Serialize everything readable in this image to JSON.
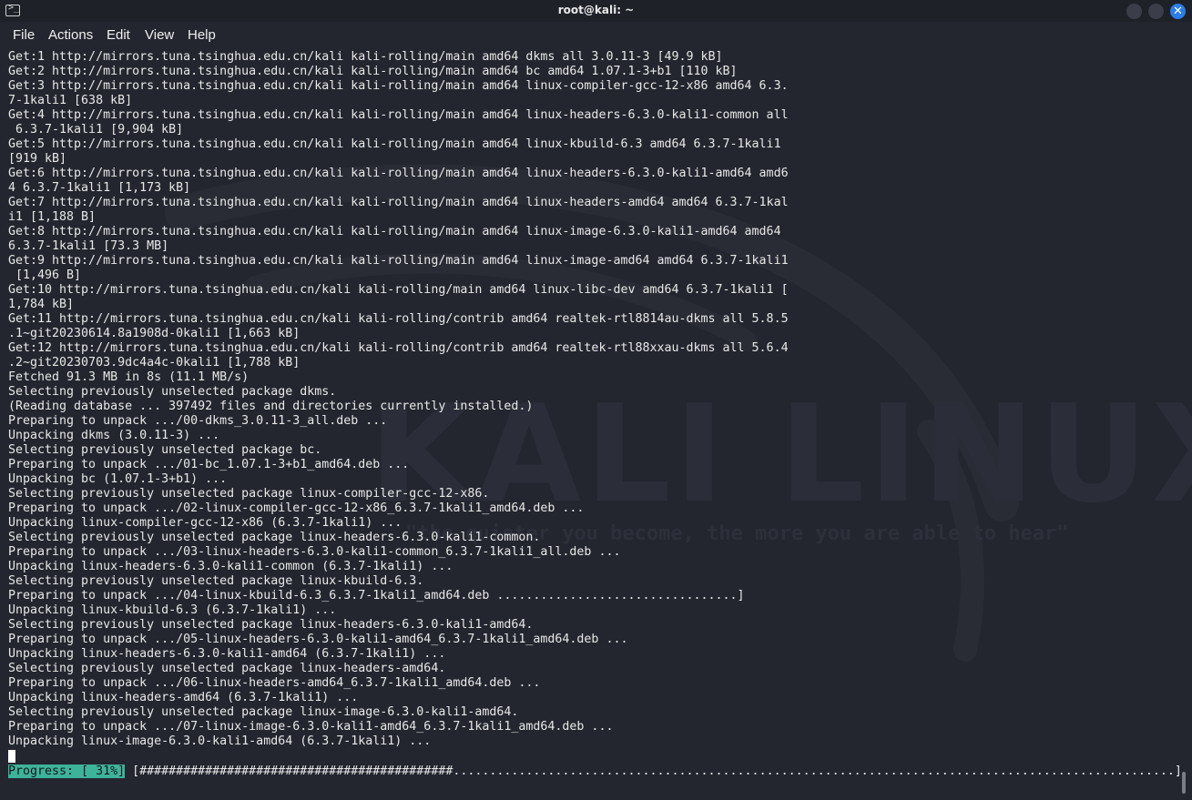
{
  "window": {
    "title": "root@kali: ~",
    "close_glyph": "✕"
  },
  "menu": {
    "items": [
      "File",
      "Actions",
      "Edit",
      "View",
      "Help"
    ]
  },
  "watermark": {
    "logo_text": "KALI LINUX",
    "tagline": "\"the quieter you become, the more you are able to hear\""
  },
  "terminal": {
    "lines": [
      "Get:1 http://mirrors.tuna.tsinghua.edu.cn/kali kali-rolling/main amd64 dkms all 3.0.11-3 [49.9 kB]",
      "Get:2 http://mirrors.tuna.tsinghua.edu.cn/kali kali-rolling/main amd64 bc amd64 1.07.1-3+b1 [110 kB]",
      "Get:3 http://mirrors.tuna.tsinghua.edu.cn/kali kali-rolling/main amd64 linux-compiler-gcc-12-x86 amd64 6.3.",
      "7-1kali1 [638 kB]",
      "Get:4 http://mirrors.tuna.tsinghua.edu.cn/kali kali-rolling/main amd64 linux-headers-6.3.0-kali1-common all",
      " 6.3.7-1kali1 [9,904 kB]",
      "Get:5 http://mirrors.tuna.tsinghua.edu.cn/kali kali-rolling/main amd64 linux-kbuild-6.3 amd64 6.3.7-1kali1",
      "[919 kB]",
      "Get:6 http://mirrors.tuna.tsinghua.edu.cn/kali kali-rolling/main amd64 linux-headers-6.3.0-kali1-amd64 amd6",
      "4 6.3.7-1kali1 [1,173 kB]",
      "Get:7 http://mirrors.tuna.tsinghua.edu.cn/kali kali-rolling/main amd64 linux-headers-amd64 amd64 6.3.7-1kal",
      "i1 [1,188 B]",
      "Get:8 http://mirrors.tuna.tsinghua.edu.cn/kali kali-rolling/main amd64 linux-image-6.3.0-kali1-amd64 amd64",
      "6.3.7-1kali1 [73.3 MB]",
      "Get:9 http://mirrors.tuna.tsinghua.edu.cn/kali kali-rolling/main amd64 linux-image-amd64 amd64 6.3.7-1kali1",
      " [1,496 B]",
      "Get:10 http://mirrors.tuna.tsinghua.edu.cn/kali kali-rolling/main amd64 linux-libc-dev amd64 6.3.7-1kali1 [",
      "1,784 kB]",
      "Get:11 http://mirrors.tuna.tsinghua.edu.cn/kali kali-rolling/contrib amd64 realtek-rtl8814au-dkms all 5.8.5",
      ".1~git20230614.8a1908d-0kali1 [1,663 kB]",
      "Get:12 http://mirrors.tuna.tsinghua.edu.cn/kali kali-rolling/contrib amd64 realtek-rtl88xxau-dkms all 5.6.4",
      ".2~git20230703.9dc4a4c-0kali1 [1,788 kB]",
      "Fetched 91.3 MB in 8s (11.1 MB/s)",
      "Selecting previously unselected package dkms.",
      "(Reading database ... 397492 files and directories currently installed.)",
      "Preparing to unpack .../00-dkms_3.0.11-3_all.deb ...",
      "Unpacking dkms (3.0.11-3) ...",
      "Selecting previously unselected package bc.",
      "Preparing to unpack .../01-bc_1.07.1-3+b1_amd64.deb ...",
      "Unpacking bc (1.07.1-3+b1) ...",
      "Selecting previously unselected package linux-compiler-gcc-12-x86.",
      "Preparing to unpack .../02-linux-compiler-gcc-12-x86_6.3.7-1kali1_amd64.deb ...",
      "Unpacking linux-compiler-gcc-12-x86 (6.3.7-1kali1) ...",
      "Selecting previously unselected package linux-headers-6.3.0-kali1-common.",
      "Preparing to unpack .../03-linux-headers-6.3.0-kali1-common_6.3.7-1kali1_all.deb ...",
      "Unpacking linux-headers-6.3.0-kali1-common (6.3.7-1kali1) ...",
      "Selecting previously unselected package linux-kbuild-6.3.",
      "Preparing to unpack .../04-linux-kbuild-6.3_6.3.7-1kali1_amd64.deb .................................]",
      "Unpacking linux-kbuild-6.3 (6.3.7-1kali1) ...",
      "Selecting previously unselected package linux-headers-6.3.0-kali1-amd64.",
      "Preparing to unpack .../05-linux-headers-6.3.0-kali1-amd64_6.3.7-1kali1_amd64.deb ...",
      "Unpacking linux-headers-6.3.0-kali1-amd64 (6.3.7-1kali1) ...",
      "Selecting previously unselected package linux-headers-amd64.",
      "Preparing to unpack .../06-linux-headers-amd64_6.3.7-1kali1_amd64.deb ...",
      "Unpacking linux-headers-amd64 (6.3.7-1kali1) ...",
      "Selecting previously unselected package linux-image-6.3.0-kali1-amd64.",
      "Preparing to unpack .../07-linux-image-6.3.0-kali1-amd64_6.3.7-1kali1_amd64.deb ...",
      "Unpacking linux-image-6.3.0-kali1-amd64 (6.3.7-1kali1) ..."
    ],
    "progress": {
      "label": "Progress: [ 31%]",
      "percent": 31,
      "bar": " [###########################################...................................................................................................]"
    }
  }
}
